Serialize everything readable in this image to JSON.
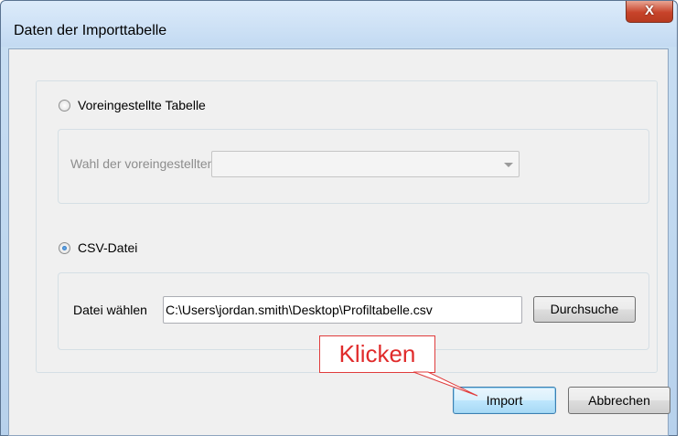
{
  "window": {
    "title": "Daten der Importtabelle",
    "close_glyph": "X"
  },
  "preset": {
    "radio_label": "Voreingestellte Tabelle",
    "checked": false,
    "select_label": "Wahl der voreingestellten Tabelle:",
    "select_value": "",
    "enabled": false
  },
  "csv": {
    "radio_label": "CSV-Datei",
    "checked": true,
    "file_label": "Datei wählen",
    "file_value": "C:\\Users\\jordan.smith\\Desktop\\Profiltabelle.csv",
    "browse_label": "Durchsuche"
  },
  "buttons": {
    "import_label": "Import",
    "cancel_label": "Abbrechen"
  },
  "annotation": {
    "text": "Klicken",
    "color": "#e02b2b"
  }
}
